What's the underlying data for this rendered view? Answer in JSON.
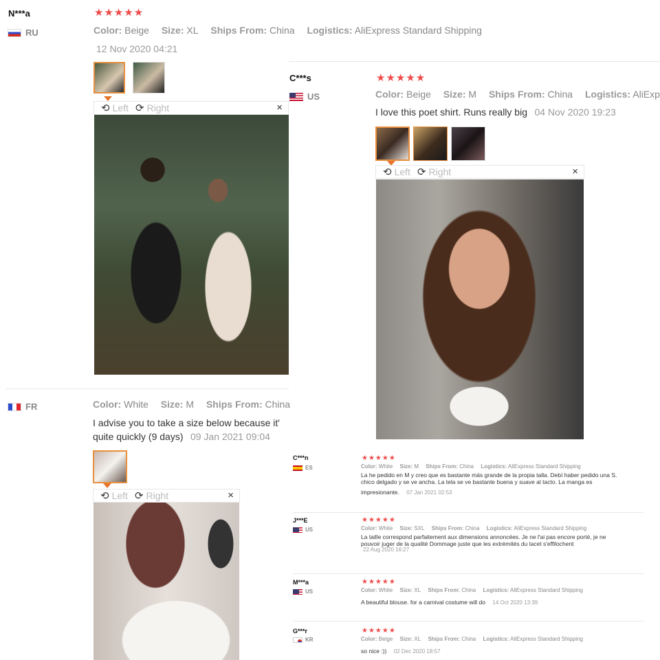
{
  "labels": {
    "color": "Color:",
    "size": "Size:",
    "ships": "Ships From:",
    "logistics": "Logistics:",
    "left": "Left",
    "right": "Right",
    "close": "×"
  },
  "icons": {
    "rotate_left": "rotate-left-icon",
    "rotate_right": "rotate-right-icon",
    "close": "close-icon",
    "star": "star-icon"
  },
  "colors": {
    "accent": "#ef4a4a",
    "thumb_active": "#e88f3c"
  },
  "reviews": [
    {
      "name": "N***a",
      "country": "RU",
      "stars": "★★★★★",
      "color": "Beige",
      "size": "XL",
      "ships": "China",
      "logistics": "AliExpress Standard Shipping",
      "date": "12 Nov 2020 04:21"
    },
    {
      "name": "C***s",
      "country": "US",
      "stars": "★★★★★",
      "color": "Beige",
      "size": "M",
      "ships": "China",
      "logistics": "AliExpress Standard Shipping",
      "text": "I love this poet shirt. Runs really big",
      "date": "04 Nov 2020 19:23"
    },
    {
      "country": "FR",
      "color": "White",
      "size": "M",
      "ships": "China",
      "text1": "I advise you to take a size below because it'",
      "text2": "quite quickly (9 days)",
      "date": "09 Jan 2021 09:04"
    },
    {
      "name": "C***n",
      "country": "ES",
      "stars": "★★★★★",
      "color": "White",
      "size": "M",
      "ships": "China",
      "logistics": "AliExpress Standard Shipping",
      "text1": "La he pedido en M y creo que es bastante más grande de la propia talla. Debí haber pedido una S.",
      "text2": "chico delgado y se ve ancha. La tela se ve bastante buena y suave al tacto. La manga es",
      "text3": "impresionante.",
      "date": "07 Jan 2021 02:53"
    },
    {
      "name": "J***E",
      "country": "US",
      "stars": "★★★★★",
      "color": "White",
      "size": "SXL",
      "ships": "China",
      "logistics": "AliExpress Standard Shipping",
      "text1": "La taille correspond parfaitement aux dimensions annoncées. Je ne l'ai pas encore porté, je ne",
      "text2": "pouvoir juger de la qualité Dommage juste que les extrémités du lacet s'effilochent",
      "date": "22 Aug 2020 16:27"
    },
    {
      "name": "M***a",
      "country": "US",
      "stars": "★★★★★",
      "color": "White",
      "size": "XL",
      "ships": "China",
      "logistics": "AliExpress Standard Shipping",
      "text": "A beautiful blouse. for a carnival costume will do",
      "date": "14 Oct 2020 13:39"
    },
    {
      "name": "G***r",
      "country": "KR",
      "stars": "★★★★★",
      "color": "Beige",
      "size": "XL",
      "ships": "China",
      "logistics": "AliExpress Standard Shipping",
      "text": "so nice :))",
      "date": "02 Dec 2020 18:57"
    }
  ]
}
